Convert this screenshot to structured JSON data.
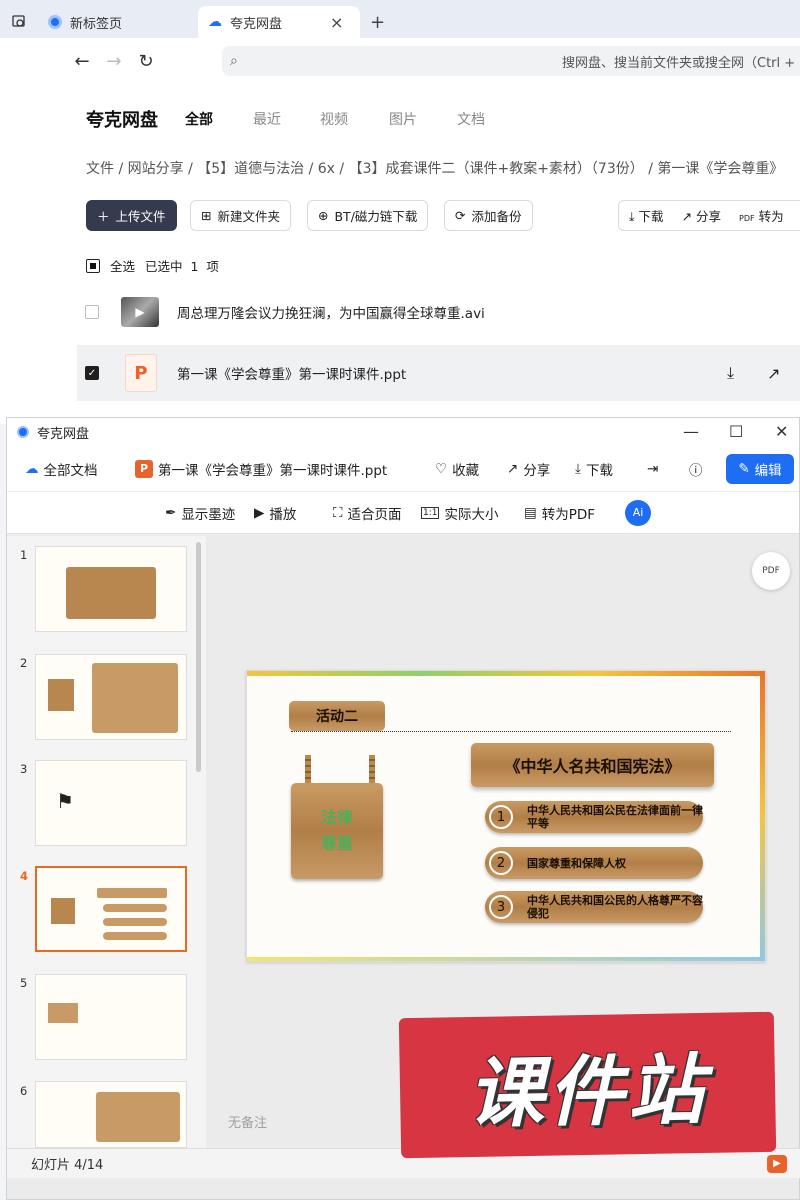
{
  "browser": {
    "tabs": [
      {
        "label": "新标签页"
      },
      {
        "label": "夸克网盘"
      }
    ],
    "new_tab": "+",
    "close_tab": "×",
    "address_placeholder": "搜网盘、搜当前文件夹或搜全网（Ctrl + F"
  },
  "drive": {
    "brand": "夸克网盘",
    "nav": [
      "全部",
      "最近",
      "视频",
      "图片",
      "文档"
    ],
    "breadcrumb": "文件 / 网站分享 / 【5】道德与法治 / 6x / 【3】成套课件二（课件+教案+素材）（73份） / 第一课《学会尊重》",
    "toolbar": {
      "upload": "上传文件",
      "new_folder": "新建文件夹",
      "bt": "BT/磁力链下载",
      "backup": "添加备份",
      "download": "下载",
      "share": "分享",
      "convert": "转为"
    },
    "select_all": "全选",
    "selected_info": "已选中  1  项",
    "files": [
      {
        "name": "周总理万隆会议力挽狂澜，为中国赢得全球尊重.avi"
      },
      {
        "name": "第一课《学会尊重》第一课时课件.ppt"
      }
    ]
  },
  "viewer": {
    "window_title": "夸克网盘",
    "all_docs": "全部文档",
    "file_name": "第一课《学会尊重》第一课时课件.ppt",
    "actions": {
      "favorite": "收藏",
      "share": "分享",
      "download": "下载",
      "edit": "编辑"
    },
    "toolbar": {
      "ink": "显示墨迹",
      "play": "播放",
      "fit": "适合页面",
      "actual": "实际大小",
      "to_pdf": "转为PDF",
      "ai": "Ai"
    },
    "slide_numbers": [
      "1",
      "2",
      "3",
      "4",
      "5",
      "6"
    ],
    "current_slide_index": 4,
    "status": "幻灯片 4/14",
    "notes": "无备注",
    "pdf_icon_label": "PDF"
  },
  "slide": {
    "activity": "活动二",
    "board_title": "《中华人名共和国宪法》",
    "hang_board": "法律\n尊重",
    "options": [
      {
        "num": "1",
        "text": "中华人民共和国公民在法律面前一律平等"
      },
      {
        "num": "2",
        "text": "国家尊重和保障人权"
      },
      {
        "num": "3",
        "text": "中华人民共和国公民的人格尊严不容侵犯"
      }
    ]
  },
  "watermark": {
    "text": "课件站"
  },
  "colors": {
    "accent_blue": "#1e6ef4",
    "ppt_orange": "#e8622b",
    "stamp_red": "#d73541",
    "wood": "#b27e47"
  }
}
